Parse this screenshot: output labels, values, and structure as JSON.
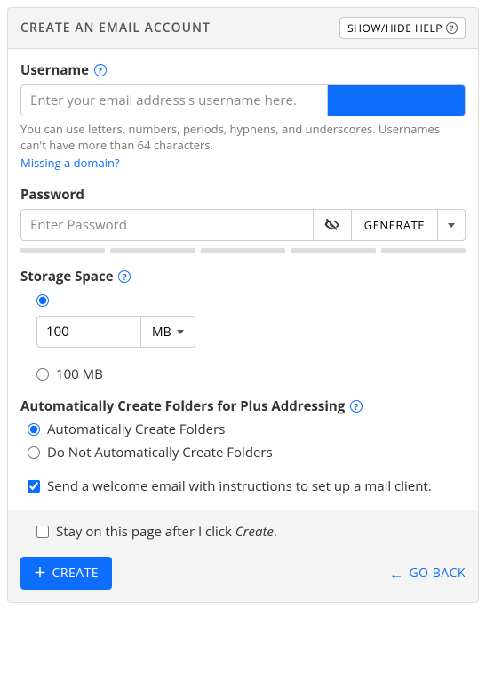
{
  "header": {
    "title": "CREATE AN EMAIL ACCOUNT",
    "help_button": "SHOW/HIDE HELP"
  },
  "username": {
    "label": "Username",
    "placeholder": "Enter your email address's username here.",
    "value": "",
    "hint": "You can use letters, numbers, periods, hyphens, and underscores. Usernames can't have more than 64 characters.",
    "missing_domain_link": "Missing a domain?"
  },
  "password": {
    "label": "Password",
    "placeholder": "Enter Password",
    "value": "",
    "generate_label": "GENERATE"
  },
  "storage": {
    "label": "Storage Space",
    "custom_value": "100",
    "unit_label": "MB",
    "preset_label": "100 MB",
    "selected": "custom"
  },
  "folders": {
    "label": "Automatically Create Folders for Plus Addressing",
    "option_auto": "Automatically Create Folders",
    "option_manual": "Do Not Automatically Create Folders",
    "selected": "auto",
    "welcome_email_label": "Send a welcome email with instructions to set up a mail client.",
    "welcome_email_checked": true
  },
  "footer": {
    "stay_label_prefix": "Stay on this page after I click ",
    "stay_label_italic": "Create",
    "stay_label_suffix": ".",
    "stay_checked": false,
    "create_button": "CREATE",
    "goback_button": "GO BACK"
  }
}
